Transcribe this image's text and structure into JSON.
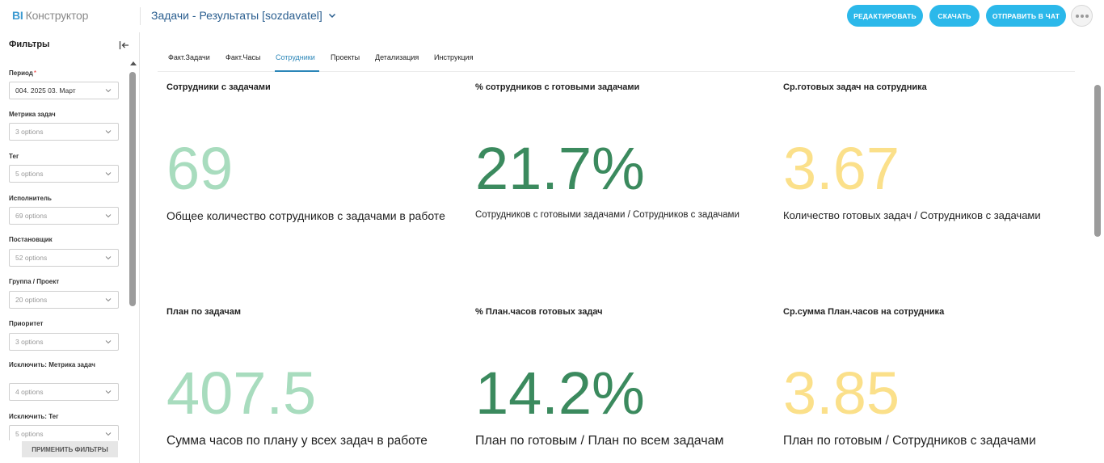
{
  "header": {
    "logo_bi": "BI",
    "logo_rest": "Конструктор",
    "report_title": "Задачи - Результаты [sozdavatel]",
    "buttons": {
      "edit": "Редактировать",
      "download": "Скачать",
      "send": "Отправить в чат"
    }
  },
  "sidebar": {
    "title": "Фильтры",
    "filters": [
      {
        "label": "Период",
        "required": "*",
        "value": "004. 2025 03. Март",
        "has_value": true
      },
      {
        "label": "Метрика задач",
        "value": "3 options"
      },
      {
        "label": "Тег",
        "value": "5 options"
      },
      {
        "label": "Исполнитель",
        "value": "69 options"
      },
      {
        "label": "Постановщик",
        "value": "52 options"
      },
      {
        "label": "Группа / Проект",
        "value": "20 options"
      },
      {
        "label": "Приоритет",
        "value": "3 options"
      },
      {
        "label": "Исключить: Метрика задач",
        "value": "4 options"
      },
      {
        "label": "Исключить: Тег",
        "value": "5 options"
      }
    ],
    "apply_button": "Применить фильтры"
  },
  "tabs": [
    {
      "label": "Факт.Задачи"
    },
    {
      "label": "Факт.Часы"
    },
    {
      "label": "Сотрудники",
      "active": true
    },
    {
      "label": "Проекты"
    },
    {
      "label": "Детализация"
    },
    {
      "label": "Инструкция"
    }
  ],
  "kpis": [
    {
      "title": "Сотрудники с задачами",
      "value": "69",
      "subtitle": "Общее количество сотрудников с задачами в работе",
      "color": "#a8dcbe"
    },
    {
      "title": "% сотрудников с готовыми задачами",
      "value": "21.7%",
      "subtitle": "Сотрудников с готовыми задачами / Сотрудников с задачами",
      "color": "#3b8a5e"
    },
    {
      "title": "Ср.готовых задач на сотрудника",
      "value": "3.67",
      "subtitle": "Количество готовых задач / Сотрудников с задачами",
      "color": "#fbe08a"
    },
    {
      "title": "План по задачам",
      "value": "407.5",
      "subtitle": "Сумма часов по плану у всех задач в работе",
      "color": "#a8dcbe"
    },
    {
      "title": "% План.часов готовых задач",
      "value": "14.2%",
      "subtitle": "План по готовым / План по всем задачам",
      "color": "#3b8a5e"
    },
    {
      "title": "Ср.сумма План.часов на сотрудника",
      "value": "3.85",
      "subtitle": "План по готовым / Сотрудников с задачами",
      "color": "#fbe08a"
    }
  ],
  "colors": {
    "accent": "#2bb8ea",
    "title_blue": "#2a5e8f",
    "tab_active": "#2b86b8"
  }
}
